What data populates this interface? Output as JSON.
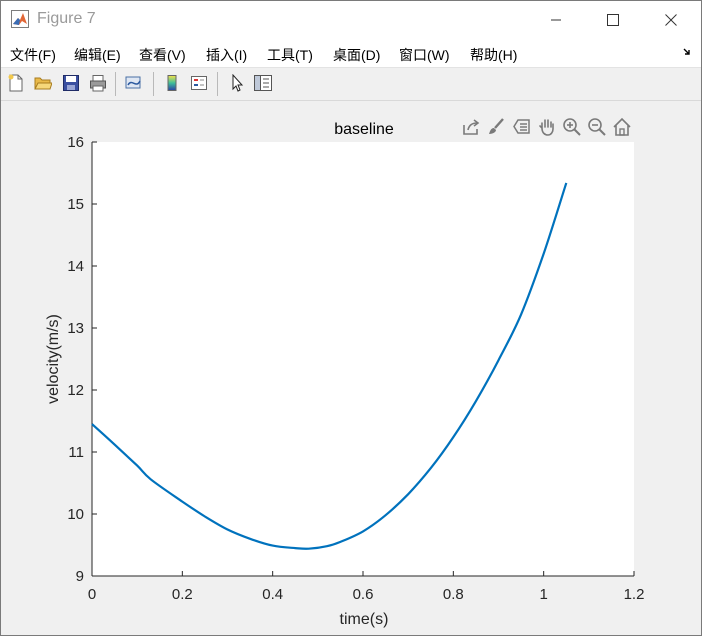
{
  "window": {
    "title": "Figure 7",
    "minimize_icon": "minimize-icon",
    "maximize_icon": "maximize-icon",
    "close_icon": "close-icon"
  },
  "menubar": {
    "items": [
      {
        "label": "文件(F)"
      },
      {
        "label": "编辑(E)"
      },
      {
        "label": "查看(V)"
      },
      {
        "label": "插入(I)"
      },
      {
        "label": "工具(T)"
      },
      {
        "label": "桌面(D)"
      },
      {
        "label": "窗口(W)"
      },
      {
        "label": "帮助(H)"
      }
    ],
    "overflow_icon": "dock-arrow-icon"
  },
  "toolbar": {
    "icons": [
      "new-figure-icon",
      "open-file-icon",
      "save-icon",
      "print-icon",
      "link-plot-icon",
      "insert-colorbar-icon",
      "insert-legend-icon",
      "edit-plot-icon",
      "property-inspector-icon"
    ]
  },
  "axes_toolbar": {
    "icons": [
      "export-icon",
      "brush-icon",
      "data-tips-icon",
      "pan-icon",
      "zoom-in-icon",
      "zoom-out-icon",
      "restore-view-icon"
    ]
  },
  "chart_data": {
    "type": "line",
    "title": "baseline",
    "xlabel": "time(s)",
    "ylabel": "velocity(m/s)",
    "xlim": [
      0,
      1.2
    ],
    "ylim": [
      9,
      16
    ],
    "xticks": [
      "0",
      "0.2",
      "0.4",
      "0.6",
      "0.8",
      "1",
      "1.2"
    ],
    "yticks": [
      "9",
      "10",
      "11",
      "12",
      "13",
      "14",
      "15",
      "16"
    ],
    "grid": false,
    "line_color": "#0072bd",
    "series": [
      {
        "x": [
          0,
          0.05,
          0.1,
          0.13,
          0.2,
          0.25,
          0.3,
          0.35,
          0.4,
          0.45,
          0.48,
          0.52,
          0.55,
          0.6,
          0.65,
          0.7,
          0.75,
          0.8,
          0.85,
          0.9,
          0.95,
          1.0,
          1.05
        ],
        "y": [
          11.45,
          11.12,
          10.78,
          10.56,
          10.2,
          9.96,
          9.75,
          9.6,
          9.49,
          9.45,
          9.44,
          9.48,
          9.55,
          9.72,
          9.98,
          10.32,
          10.74,
          11.24,
          11.82,
          12.48,
          13.22,
          14.2,
          15.34
        ]
      }
    ]
  }
}
